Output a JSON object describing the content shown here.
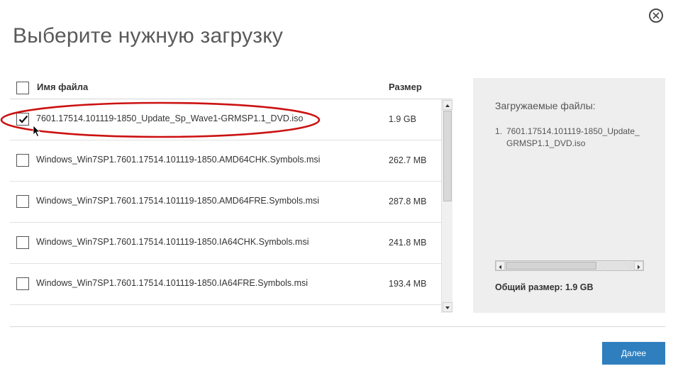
{
  "dialog": {
    "title": "Выберите нужную загрузку"
  },
  "table": {
    "header": {
      "name": "Имя файла",
      "size": "Размер"
    },
    "rows": [
      {
        "name": "7601.17514.101119-1850_Update_Sp_Wave1-GRMSP1.1_DVD.iso",
        "size": "1.9 GB",
        "checked": true
      },
      {
        "name": "Windows_Win7SP1.7601.17514.101119-1850.AMD64CHK.Symbols.msi",
        "size": "262.7 MB",
        "checked": false
      },
      {
        "name": "Windows_Win7SP1.7601.17514.101119-1850.AMD64FRE.Symbols.msi",
        "size": "287.8 MB",
        "checked": false
      },
      {
        "name": "Windows_Win7SP1.7601.17514.101119-1850.IA64CHK.Symbols.msi",
        "size": "241.8 MB",
        "checked": false
      },
      {
        "name": "Windows_Win7SP1.7601.17514.101119-1850.IA64FRE.Symbols.msi",
        "size": "193.4 MB",
        "checked": false
      }
    ]
  },
  "summary": {
    "title": "Загружаемые файлы:",
    "items": [
      {
        "num": "1.",
        "line1": "7601.17514.101119-1850_Update_",
        "line2": "GRMSP1.1_DVD.iso"
      }
    ],
    "total": "Общий размер: 1.9 GB"
  },
  "buttons": {
    "next": "Далее"
  },
  "colors": {
    "accent": "#2f7fbf",
    "highlight_ellipse": "#cc1111",
    "panel_bg": "#eeeeee"
  },
  "icons": [
    "close-icon",
    "checkmark-icon",
    "mouse-cursor-icon",
    "scroll-up-arrow-icon",
    "scroll-down-arrow-icon",
    "scroll-left-arrow-icon",
    "scroll-right-arrow-icon"
  ]
}
